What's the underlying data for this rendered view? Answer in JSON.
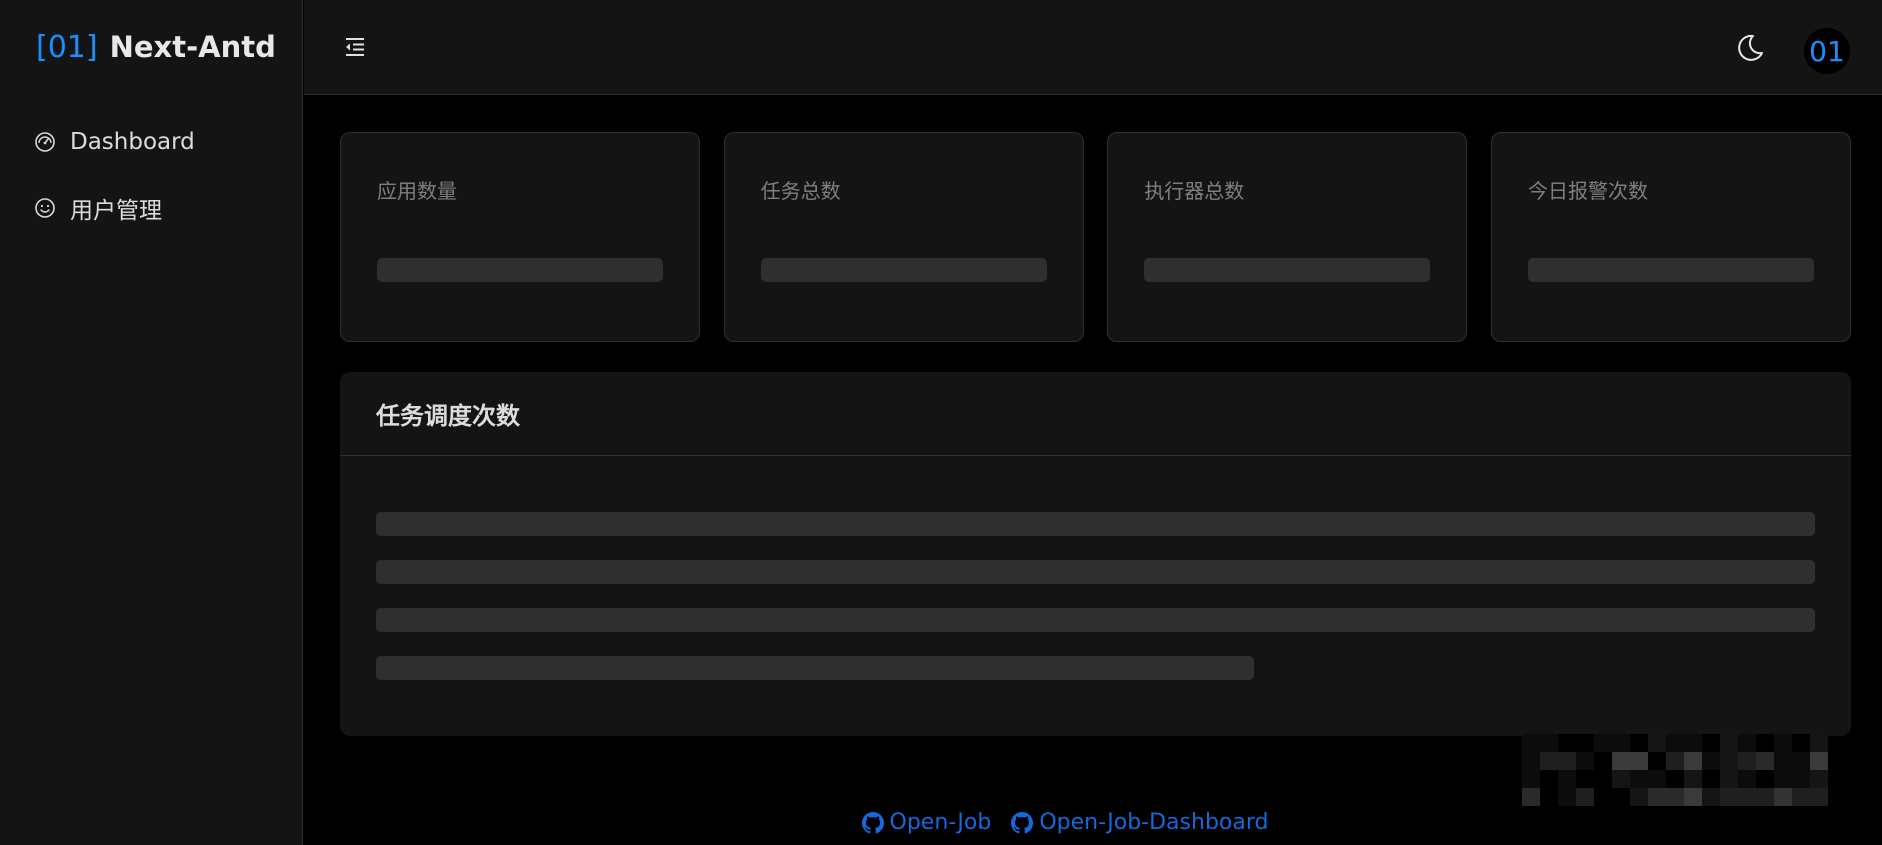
{
  "app": {
    "logo_mark": "[01]",
    "logo_text": "Next-Antd"
  },
  "sidebar": {
    "items": [
      {
        "label": "Dashboard",
        "icon": "dashboard-icon"
      },
      {
        "label": "用户管理",
        "icon": "smile-icon"
      }
    ]
  },
  "header": {
    "fold_icon": "menu-fold-icon",
    "theme_icon": "moon-icon",
    "avatar_text": "01"
  },
  "stats": [
    {
      "title": "应用数量"
    },
    {
      "title": "任务总数"
    },
    {
      "title": "执行器总数"
    },
    {
      "title": "今日报警次数"
    }
  ],
  "schedule_card": {
    "title": "任务调度次数"
  },
  "footer": {
    "links": [
      {
        "label": "Open-Job",
        "icon": "github-icon"
      },
      {
        "label": "Open-Job-Dashboard",
        "icon": "github-icon"
      }
    ]
  },
  "colors": {
    "brand": "#1890ff",
    "link": "#1668dc",
    "page_bg": "#000000",
    "panel_bg": "#141414",
    "skeleton": "#2f2f2f"
  }
}
